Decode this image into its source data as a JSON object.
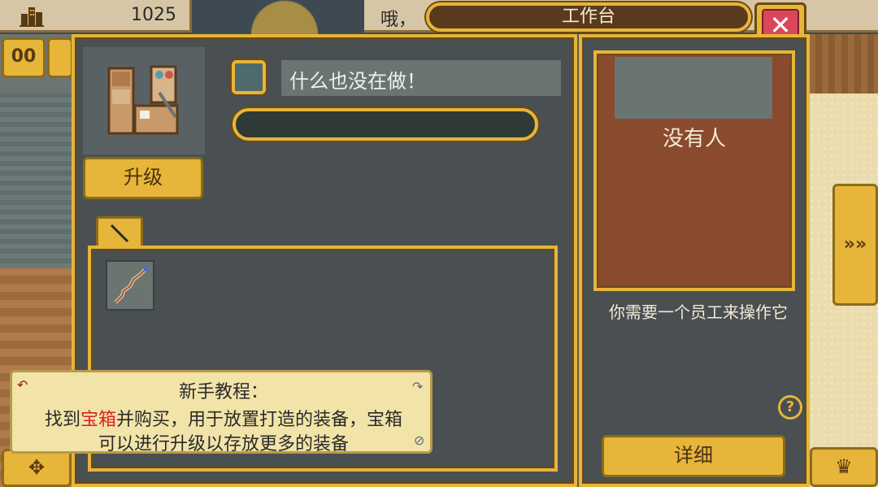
{
  "hud": {
    "money": "1025",
    "message": "哦，",
    "pause_label": "00",
    "next_label": "»»",
    "move_label": "✥",
    "crown_label": "♛"
  },
  "window": {
    "title": "工作台",
    "close_label": "✕"
  },
  "station": {
    "upgrade_label": "升级",
    "status_text": "什么也没在做！",
    "progress": 0
  },
  "tabs": [
    {
      "icon": "tool-icon"
    }
  ],
  "items": [
    {
      "icon": "staff-icon"
    }
  ],
  "worker": {
    "name": "没有人",
    "note": "你需要一个员工来操作它",
    "help_label": "?",
    "details_label": "详细"
  },
  "tutorial": {
    "title": "新手教程：",
    "line1_prefix": "找到",
    "line1_highlight": "宝箱",
    "line1_suffix": "并购买，用于放置打造的装备，宝箱",
    "line2": "可以进行升级以存放更多的装备"
  },
  "colors": {
    "gold": "#e6b53a",
    "panel": "#4a4f52",
    "worker_bg": "#8a4a2e",
    "highlight": "#d8202a"
  }
}
